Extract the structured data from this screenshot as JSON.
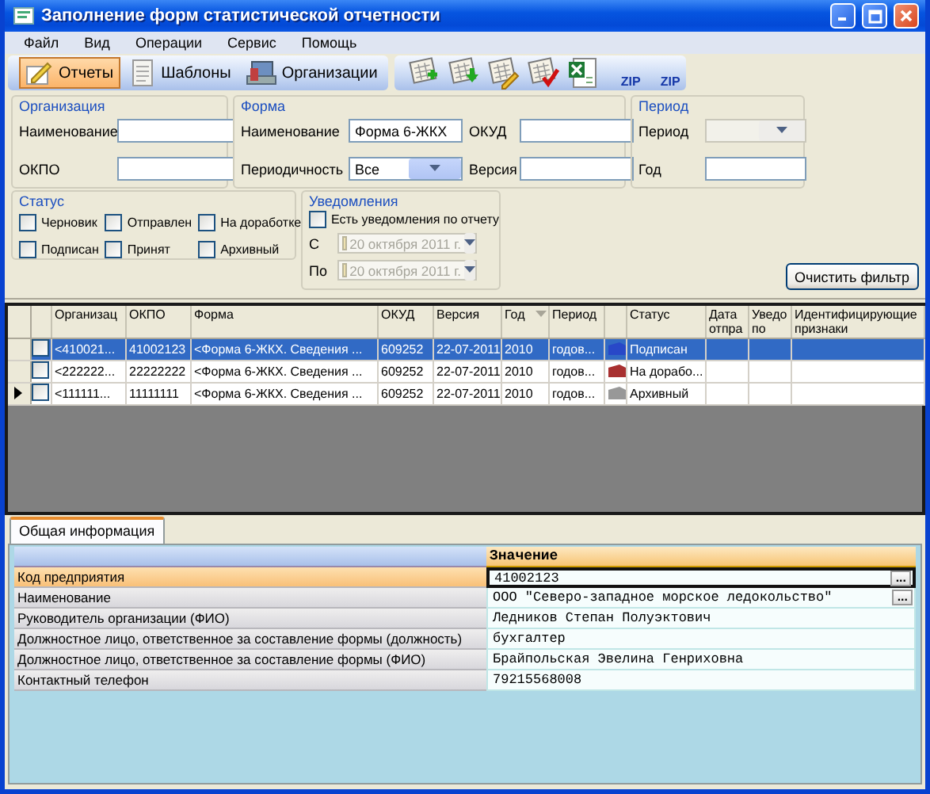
{
  "window": {
    "title": "Заполнение форм статистической отчетности"
  },
  "menu": [
    "Файл",
    "Вид",
    "Операции",
    "Сервис",
    "Помощь"
  ],
  "toolbar": {
    "buttons": [
      {
        "label": "Отчеты",
        "selected": true
      },
      {
        "label": "Шаблоны",
        "selected": false
      },
      {
        "label": "Организации",
        "selected": false
      }
    ],
    "actions": [
      {
        "kind": "add"
      },
      {
        "kind": "download"
      },
      {
        "kind": "edit"
      },
      {
        "kind": "check"
      },
      {
        "kind": "excel"
      },
      {
        "kind": "zip",
        "label": "ZIP"
      },
      {
        "kind": "zip",
        "label": "ZIP"
      }
    ]
  },
  "filter": {
    "organization": {
      "title": "Организация",
      "fields": [
        {
          "label": "Наименование",
          "kind": "text",
          "disabled": false
        },
        {
          "label": "ОКПО",
          "kind": "text",
          "disabled": false
        }
      ]
    },
    "form": {
      "title": "Форма",
      "fields": [
        {
          "label": "Наименование",
          "kind": "text",
          "value": "Форма 6-ЖКХ",
          "disabled": false
        },
        {
          "label": "ОКУД",
          "kind": "text",
          "disabled": false
        },
        {
          "label": "Периодичность",
          "kind": "combo",
          "value": "Все",
          "disabled": false
        },
        {
          "label": "Версия",
          "kind": "text",
          "disabled": false
        }
      ]
    },
    "period": {
      "title": "Период",
      "fields": [
        {
          "label": "Период",
          "kind": "combo",
          "disabled": true
        },
        {
          "label": "Год",
          "kind": "text",
          "disabled": false
        }
      ]
    },
    "status": {
      "title": "Статус",
      "options": [
        {
          "label": "Черновик",
          "checked": false
        },
        {
          "label": "Отправлен",
          "checked": false
        },
        {
          "label": "На доработке",
          "checked": false
        },
        {
          "label": "Подписан",
          "checked": false
        },
        {
          "label": "Принят",
          "checked": false
        },
        {
          "label": "Архивный",
          "checked": false
        }
      ]
    },
    "notifications": {
      "title": "Уведомления",
      "option": {
        "label": "Есть уведомления по отчету",
        "checked": false
      },
      "dates": [
        {
          "label": "С",
          "value": "20 октября 2011 г.",
          "checked": false,
          "disabled": true
        },
        {
          "label": "По",
          "value": "20 октября 2011 г.",
          "checked": false,
          "disabled": true
        }
      ]
    },
    "clear_button": "Очистить фильтр"
  },
  "grid": {
    "columns": [
      {
        "label": "Организац",
        "kind": "text",
        "sorted": false
      },
      {
        "label": "ОКПО",
        "kind": "text",
        "sorted": false
      },
      {
        "label": "Форма",
        "kind": "text",
        "sorted": false
      },
      {
        "label": "ОКУД",
        "kind": "text",
        "sorted": false
      },
      {
        "label": "Версия",
        "kind": "text",
        "sorted": false
      },
      {
        "label": "Год",
        "kind": "text",
        "sorted": true
      },
      {
        "label": "Период",
        "kind": "text",
        "sorted": false
      },
      {
        "label": "Статус",
        "kind": "status",
        "sorted": false
      },
      {
        "label": "Дата отпра",
        "kind": "text",
        "sorted": false
      },
      {
        "label": "Уведо по",
        "kind": "text",
        "sorted": false
      },
      {
        "label": "Идентифицирующие признаки",
        "kind": "text",
        "sorted": false
      }
    ],
    "rows": [
      {
        "selected": true,
        "checked": false,
        "current": false,
        "color": "#2848c8",
        "cells": [
          "<410021...",
          "41002123",
          "<Форма 6-ЖКХ. Сведения ...",
          "609252",
          "22-07-2011",
          "2010",
          "годов...",
          "Подписан"
        ]
      },
      {
        "selected": false,
        "checked": false,
        "current": false,
        "color": "#a83030",
        "cells": [
          "<222222...",
          "22222222",
          "<Форма 6-ЖКХ. Сведения ...",
          "609252",
          "22-07-2011",
          "2010",
          "годов...",
          "На дорабо..."
        ]
      },
      {
        "selected": false,
        "checked": false,
        "current": true,
        "color": "#989898",
        "cells": [
          "<111111...",
          "11111111",
          "<Форма 6-ЖКХ. Сведения ...",
          "609252",
          "22-07-2011",
          "2010",
          "годов...",
          "Архивный"
        ]
      }
    ]
  },
  "details": {
    "tabs": [
      {
        "label": "Общая информация",
        "selected": true
      }
    ],
    "header": "Значение",
    "rows": [
      {
        "name": "Код предприятия",
        "value": "41002123",
        "selected": true,
        "button": "..."
      },
      {
        "name": "Наименование",
        "value": "ООО \"Северо-западное морское ледокольство\"",
        "selected": false,
        "button": "..."
      },
      {
        "name": "Руководитель организации (ФИО)",
        "value": "Ледников Степан Полуэктович",
        "selected": false
      },
      {
        "name": "Должностное лицо, ответственное за составление формы (должность)",
        "value": "бухгалтер",
        "selected": false
      },
      {
        "name": "Должностное лицо, ответственное за составление формы (ФИО)",
        "value": "Брайпольская Эвелина Генриховна",
        "selected": false
      },
      {
        "name": "Контактный телефон",
        "value": "79215568008",
        "selected": false
      }
    ]
  }
}
